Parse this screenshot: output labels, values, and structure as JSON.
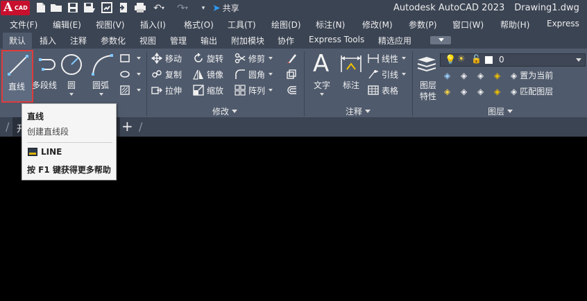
{
  "app": {
    "logo_letter": "A",
    "logo_sub": "CAD",
    "product": "Autodesk AutoCAD 2023",
    "document": "Drawing1.dwg"
  },
  "quick_access": {
    "share_label": "共享"
  },
  "menu": {
    "items": [
      "文件(F)",
      "编辑(E)",
      "视图(V)",
      "插入(I)",
      "格式(O)",
      "工具(T)",
      "绘图(D)",
      "标注(N)",
      "修改(M)",
      "参数(P)",
      "窗口(W)",
      "帮助(H)",
      "Express"
    ]
  },
  "ribbon_tabs": {
    "items": [
      "默认",
      "插入",
      "注释",
      "参数化",
      "视图",
      "管理",
      "输出",
      "附加模块",
      "协作",
      "Express Tools",
      "精选应用"
    ],
    "active": "默认"
  },
  "draw_panel": {
    "line": "直线",
    "polyline": "多段线",
    "circle": "圆",
    "arc": "圆弧"
  },
  "modify_panel": {
    "title": "修改",
    "move": "移动",
    "rotate": "旋转",
    "trim": "修剪",
    "copy": "复制",
    "mirror": "镜像",
    "fillet": "圆角",
    "stretch": "拉伸",
    "scale": "缩放",
    "array": "阵列"
  },
  "annotation_panel": {
    "title": "注释",
    "text": "文字",
    "dimension": "标注",
    "linear": "线性",
    "leader": "引线",
    "table": "表格"
  },
  "layers_panel": {
    "title": "图层",
    "properties_line1": "图层",
    "properties_line2": "特性",
    "current_layer": "0",
    "make_current": "置为当前",
    "match_layer": "匹配图层"
  },
  "file_tabs": {
    "start_tab": "开"
  },
  "tooltip": {
    "title": "直线",
    "description": "创建直线段",
    "command": "LINE",
    "help": "按 F1 键获得更多帮助"
  },
  "colors": {
    "title_bg": "#3b4453",
    "ribbon_bg": "#4f5a6c",
    "highlight_border": "#e03b3b",
    "logo_red": "#c8102e",
    "share_blue": "#2e9cf6"
  }
}
